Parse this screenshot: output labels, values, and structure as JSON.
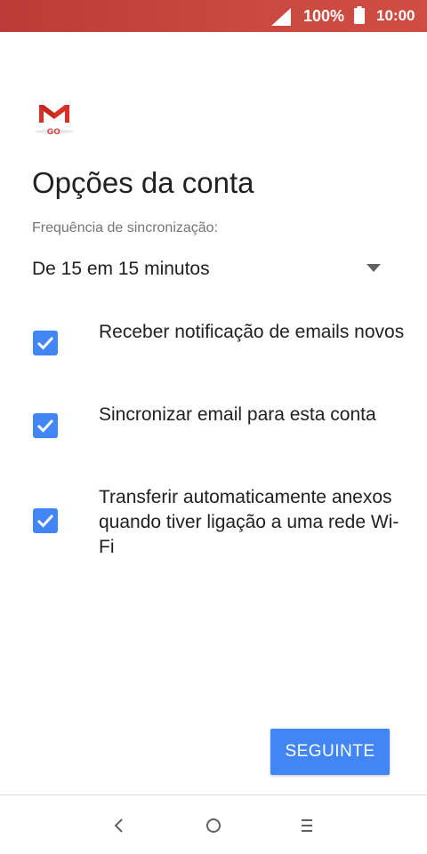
{
  "status_bar": {
    "battery_percent": "100%",
    "time": "10:00",
    "background_color": "#c5443d",
    "icons": [
      "signal-icon",
      "battery-icon"
    ]
  },
  "app": {
    "logo_text": "GO",
    "logo_icon": "gmail-go-logo"
  },
  "page": {
    "title": "Opções da conta"
  },
  "sync": {
    "label": "Frequência de sincronização:",
    "selected_value": "De 15 em 15 minutos",
    "icon": "dropdown-caret-icon"
  },
  "options": [
    {
      "label": "Receber notificação de emails novos",
      "checked": true
    },
    {
      "label": "Sincronizar email para esta conta",
      "checked": true
    },
    {
      "label": "Transferir automaticamente anexos quando tiver ligação a uma rede Wi-Fi",
      "checked": true
    }
  ],
  "actions": {
    "next_label": "SEGUINTE",
    "accent_color": "#4285f4"
  },
  "nav_bar": {
    "icons": [
      "back-icon",
      "home-icon",
      "recents-icon"
    ]
  }
}
